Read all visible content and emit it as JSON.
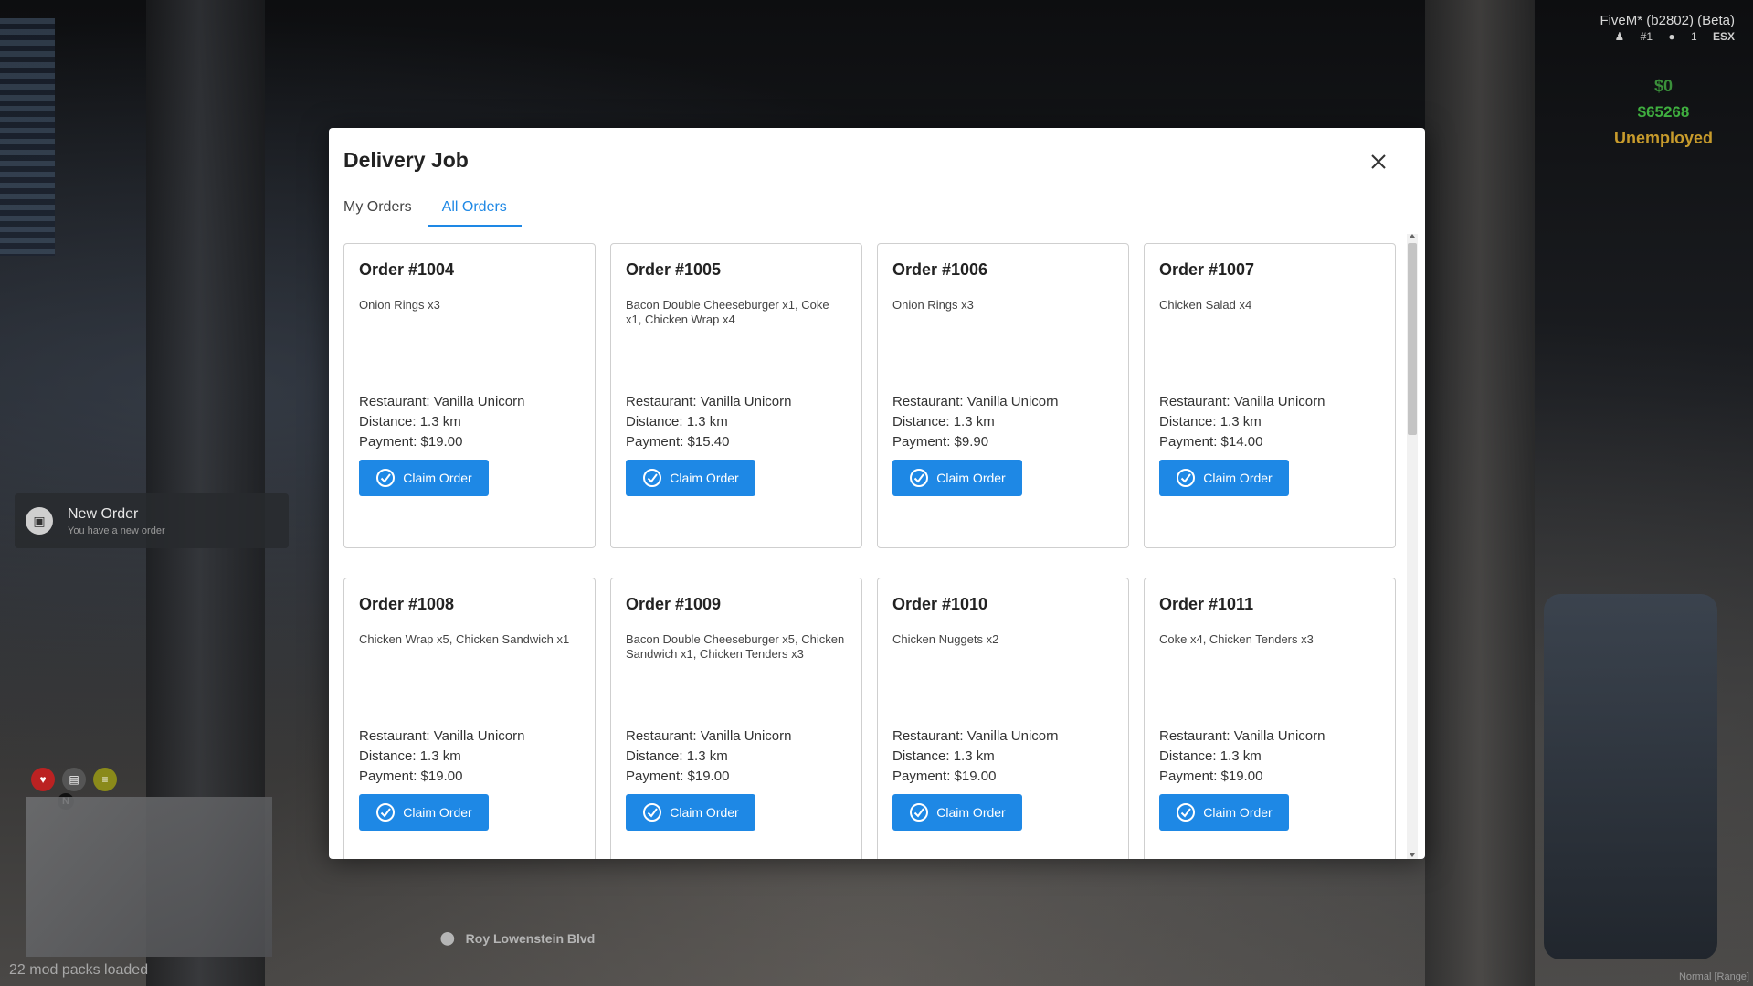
{
  "hud": {
    "server": "FiveM* (b2802) (Beta)",
    "player_id": "#1",
    "player_count": "1",
    "framework": "ESX",
    "cash": "$0",
    "bank": "$65268",
    "job": "Unemployed"
  },
  "notification": {
    "title": "New Order",
    "subtitle": "You have a new order"
  },
  "footer": {
    "mods_loaded": "22 mod packs loaded",
    "street": "Roy Lowenstein Blvd",
    "voice_mode": "Normal [Range]",
    "north": "N"
  },
  "modal": {
    "title": "Delivery Job",
    "tabs": [
      {
        "label": "My Orders"
      },
      {
        "label": "All Orders"
      }
    ],
    "claim_label": "Claim Order",
    "orders": [
      {
        "title": "Order #1004",
        "items": "Onion Rings x3",
        "restaurant": "Restaurant: Vanilla Unicorn",
        "distance": "Distance: 1.3 km",
        "payment": "Payment: $19.00"
      },
      {
        "title": "Order #1005",
        "items": "Bacon Double Cheeseburger x1, Coke x1, Chicken Wrap x4",
        "restaurant": "Restaurant: Vanilla Unicorn",
        "distance": "Distance: 1.3 km",
        "payment": "Payment: $15.40"
      },
      {
        "title": "Order #1006",
        "items": "Onion Rings x3",
        "restaurant": "Restaurant: Vanilla Unicorn",
        "distance": "Distance: 1.3 km",
        "payment": "Payment: $9.90"
      },
      {
        "title": "Order #1007",
        "items": "Chicken Salad x4",
        "restaurant": "Restaurant: Vanilla Unicorn",
        "distance": "Distance: 1.3 km",
        "payment": "Payment: $14.00"
      },
      {
        "title": "Order #1008",
        "items": "Chicken Wrap x5, Chicken Sandwich x1",
        "restaurant": "Restaurant: Vanilla Unicorn",
        "distance": "Distance: 1.3 km",
        "payment": "Payment: $19.00"
      },
      {
        "title": "Order #1009",
        "items": "Bacon Double Cheeseburger x5, Chicken Sandwich x1, Chicken Tenders x3",
        "restaurant": "Restaurant: Vanilla Unicorn",
        "distance": "Distance: 1.3 km",
        "payment": "Payment: $19.00"
      },
      {
        "title": "Order #1010",
        "items": "Chicken Nuggets x2",
        "restaurant": "Restaurant: Vanilla Unicorn",
        "distance": "Distance: 1.3 km",
        "payment": "Payment: $19.00"
      },
      {
        "title": "Order #1011",
        "items": "Coke x4, Chicken Tenders x3",
        "restaurant": "Restaurant: Vanilla Unicorn",
        "distance": "Distance: 1.3 km",
        "payment": "Payment: $19.00"
      }
    ]
  },
  "colors": {
    "accent": "#1e88e5",
    "cash": "#3a8f3a",
    "bank": "#3fae3f",
    "job": "#c79b2c"
  }
}
